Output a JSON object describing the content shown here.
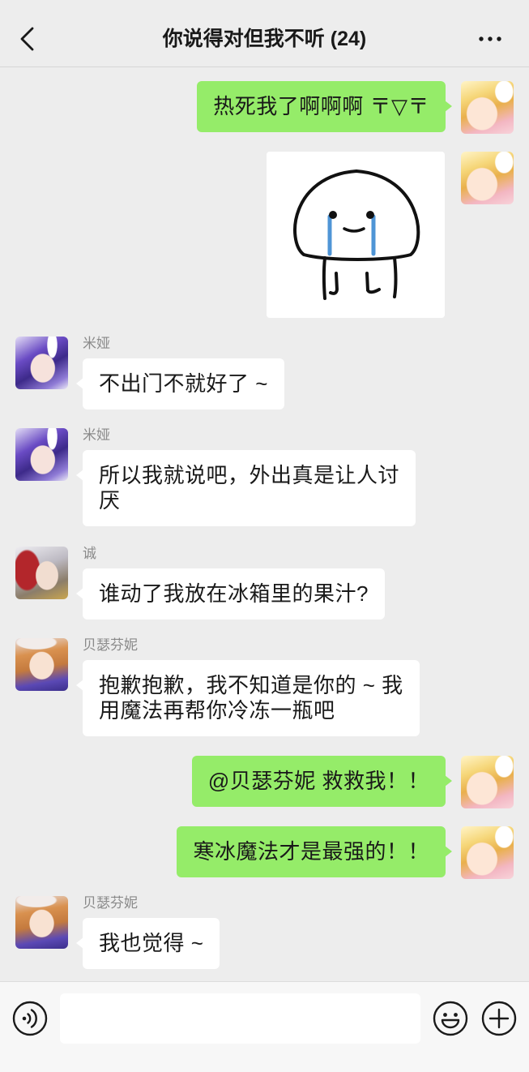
{
  "header": {
    "title": "你说得对但我不听 (24)",
    "back_icon": "chevron-left-icon",
    "more_icon": "more-dots-icon"
  },
  "messages": [
    {
      "outgoing": true,
      "lines": [
        "热死我了啊啊啊 〒▽〒"
      ]
    },
    {
      "outgoing": true,
      "sticker": "crying-blob-sticker"
    },
    {
      "outgoing": false,
      "sender": "米娅",
      "lines": [
        "不出门不就好了 ~"
      ]
    },
    {
      "outgoing": false,
      "sender": "米娅",
      "lines": [
        "所以我就说吧，外出真是让人讨",
        "厌"
      ]
    },
    {
      "outgoing": false,
      "sender": "诚",
      "lines": [
        "谁动了我放在冰箱里的果汁?"
      ]
    },
    {
      "outgoing": false,
      "sender": "贝瑟芬妮",
      "lines": [
        "抱歉抱歉，我不知道是你的 ~ 我",
        "用魔法再帮你冷冻一瓶吧"
      ]
    },
    {
      "outgoing": true,
      "lines": [
        "@贝瑟芬妮 救救我！！"
      ]
    },
    {
      "outgoing": true,
      "lines": [
        "寒冰魔法才是最强的！！"
      ]
    },
    {
      "outgoing": false,
      "sender": "贝瑟芬妮",
      "lines": [
        "我也觉得 ~"
      ]
    }
  ],
  "input_bar": {
    "value": "",
    "voice_icon": "voice-icon",
    "emoji_icon": "emoji-icon",
    "plus_icon": "plus-icon"
  },
  "colors": {
    "background": "#ededed",
    "outgoing_bubble": "#95ec69",
    "incoming_bubble": "#ffffff",
    "sender_name": "#8a8a8a",
    "text": "#191919",
    "input_bar": "#f7f7f7",
    "tear": "#4f95d6"
  }
}
